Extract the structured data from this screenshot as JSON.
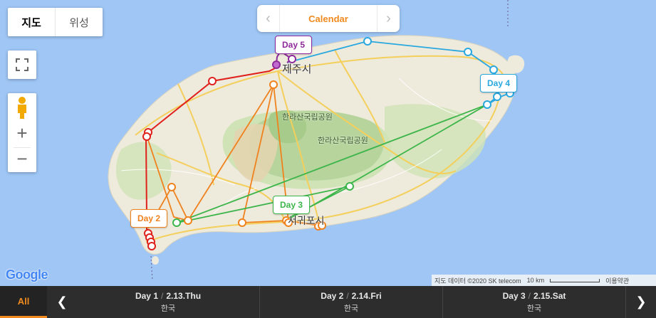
{
  "map_type": {
    "map_label": "지도",
    "satellite_label": "위성"
  },
  "calendar": {
    "label": "Calendar"
  },
  "day_tags": {
    "day2": "Day 2",
    "day3": "Day 3",
    "day4": "Day 4",
    "day5": "Day 5"
  },
  "map_labels": {
    "city_north": "제주시",
    "city_south": "서귀포시",
    "park_1": "한라산국립공원",
    "park_2": "한라산국립공원"
  },
  "route_colors": {
    "day1": "#e0201a",
    "day2": "#f0821e",
    "day3": "#3cb54a",
    "day4": "#29a8e0",
    "day5": "#8e2a9c"
  },
  "attribution": {
    "data": "지도 데이터 ©2020 SK telecom",
    "scale": "10 km",
    "terms": "이용약관"
  },
  "google_logo": "Google",
  "bottom_bar": {
    "all_label": "All",
    "days": [
      {
        "day": "Day 1",
        "date": "2.13.Thu",
        "region": "한국"
      },
      {
        "day": "Day 2",
        "date": "2.14.Fri",
        "region": "한국"
      },
      {
        "day": "Day 3",
        "date": "2.15.Sat",
        "region": "한국"
      }
    ]
  }
}
